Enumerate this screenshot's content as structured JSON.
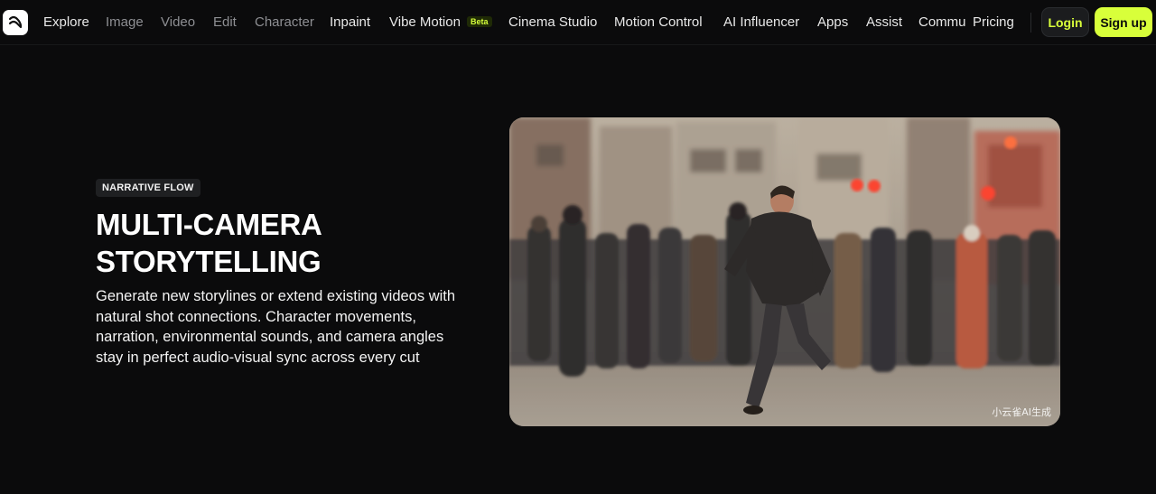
{
  "nav": {
    "logo_icon": "brand-logo-icon",
    "items": [
      {
        "label": "Explore",
        "active": true
      },
      {
        "label": "Image",
        "active": false
      },
      {
        "label": "Video",
        "active": false
      },
      {
        "label": "Edit",
        "active": false
      },
      {
        "label": "Character",
        "active": false
      },
      {
        "label": "Inpaint",
        "active": true
      },
      {
        "label": "Vibe Motion",
        "active": true,
        "badge": "Beta"
      },
      {
        "label": "Cinema Studio",
        "active": true
      },
      {
        "label": "Motion Control",
        "active": true
      },
      {
        "label": "AI Influencer",
        "active": true
      },
      {
        "label": "Apps",
        "active": true
      },
      {
        "label": "Assist",
        "active": true
      },
      {
        "label": "Commu",
        "active": true
      },
      {
        "label": "Pricing",
        "active": true
      }
    ],
    "login_label": "Login",
    "signup_label": "Sign up"
  },
  "hero": {
    "tag": "NARRATIVE FLOW",
    "title_line1": "MULTI-CAMERA",
    "title_line2": "STORYTELLING",
    "description": "Generate new storylines or extend existing videos with natural shot connections. Character movements, narration, environmental sounds, and camera angles stay in perfect audio-visual sync across every cut",
    "media_watermark": "小云雀AI生成"
  },
  "colors": {
    "accent": "#d8ff3a",
    "background": "#0b0b0c",
    "muted_text": "#8e8f93"
  }
}
